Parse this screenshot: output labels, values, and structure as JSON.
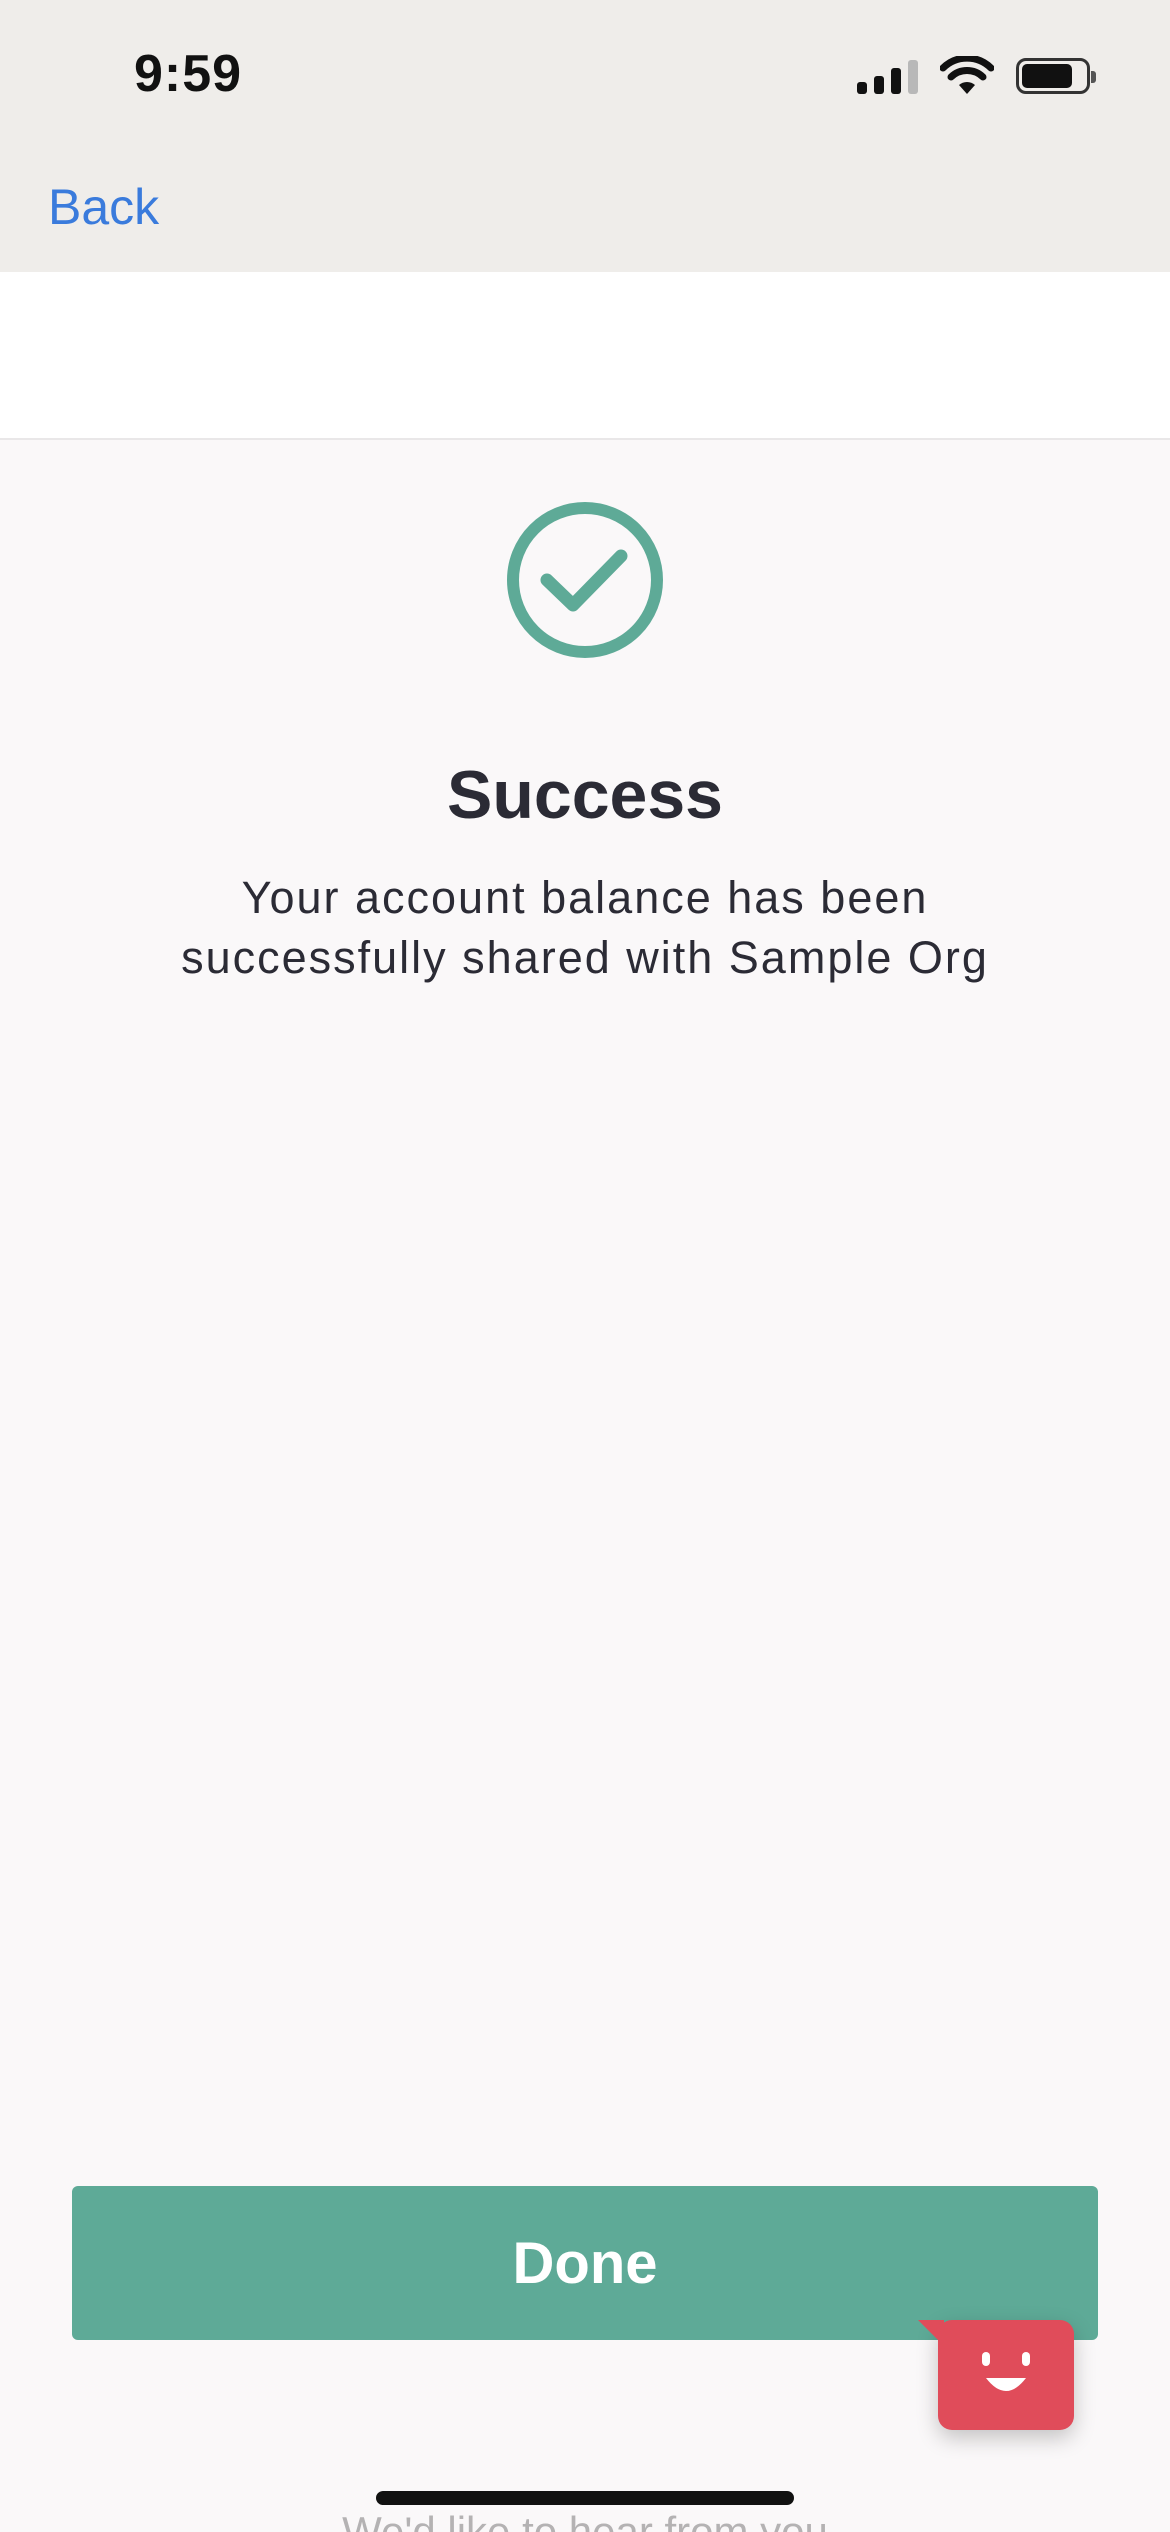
{
  "status_bar": {
    "time": "9:59",
    "icons": [
      "cellular-signal-icon",
      "wifi-icon",
      "battery-icon"
    ]
  },
  "nav": {
    "back_label": "Back"
  },
  "success": {
    "icon": "check-circle-icon",
    "title": "Success",
    "message": "Your account balance has been successfully shared with Sample Org"
  },
  "actions": {
    "done_label": "Done"
  },
  "feedback": {
    "icon": "smiley-face-icon",
    "teaser_text": "We'd like to hear from you"
  },
  "colors": {
    "accent_green": "#5eaa97",
    "link_blue": "#3a7bdc",
    "feedback_red": "#e04c5a",
    "top_bar_bg": "#efedea",
    "page_bg": "#faf8f9"
  }
}
